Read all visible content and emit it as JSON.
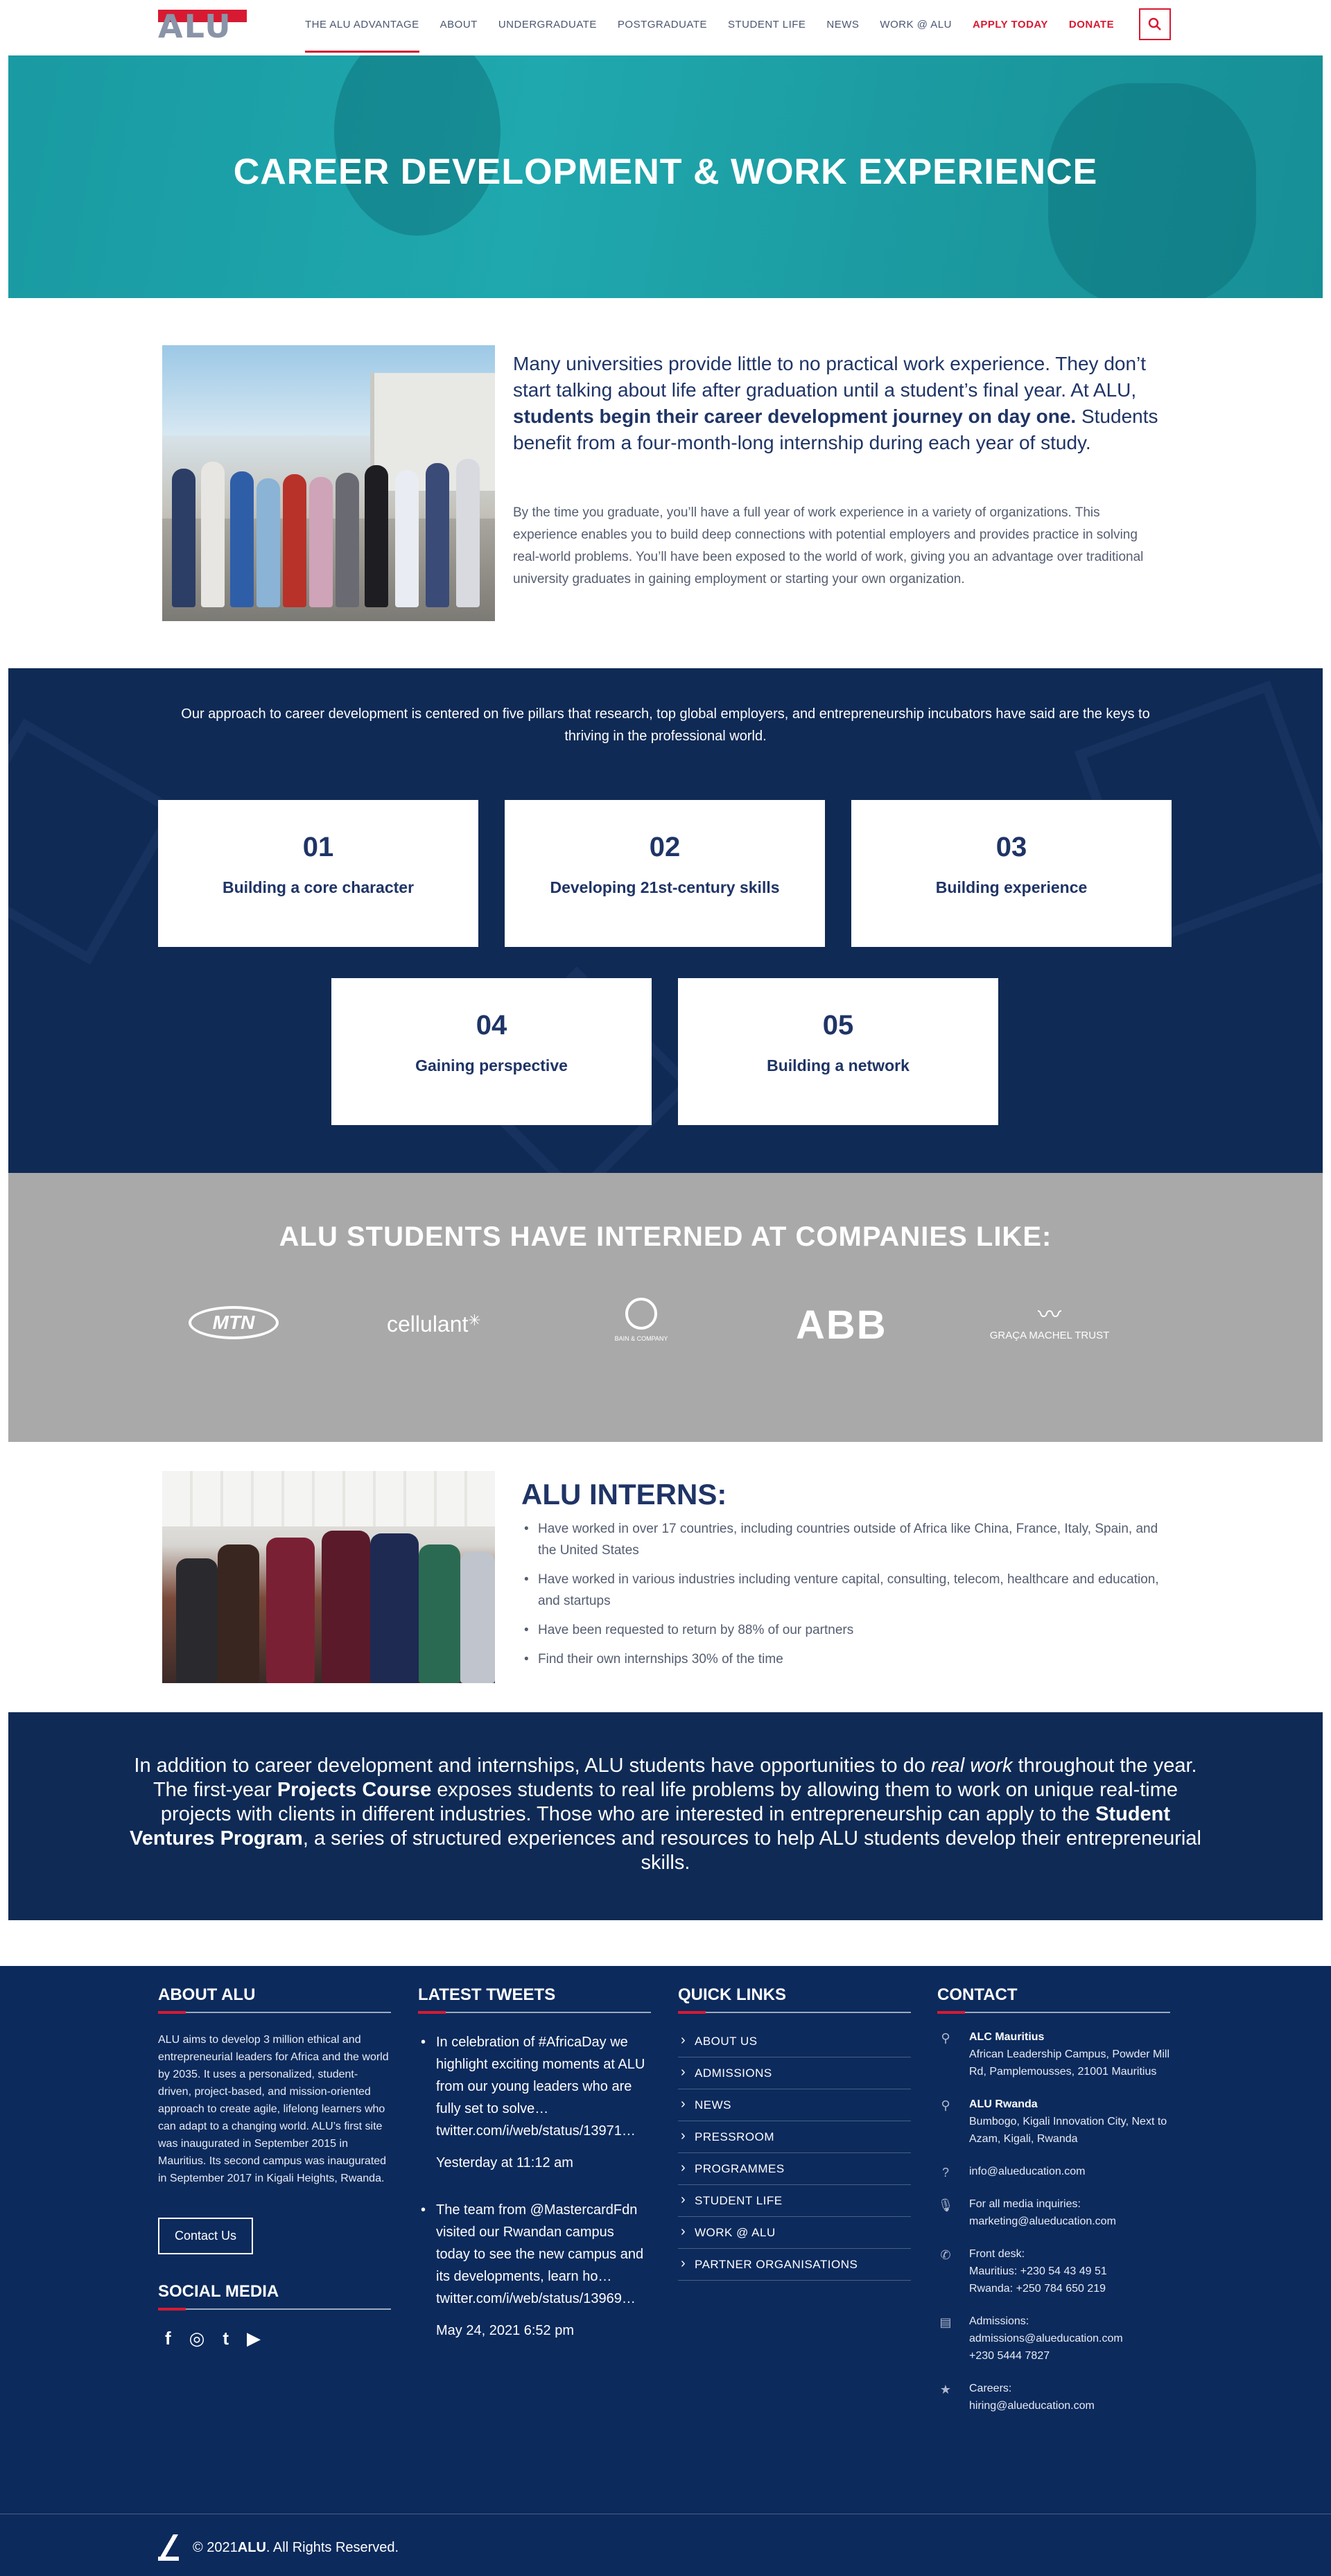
{
  "brand": {
    "logo_text": "ALU",
    "accent": "#d71a32",
    "navy": "#0f2a55",
    "teal": "#1fa8ae"
  },
  "nav": {
    "items": [
      "THE ALU ADVANTAGE",
      "ABOUT",
      "UNDERGRADUATE",
      "POSTGRADUATE",
      "STUDENT LIFE",
      "NEWS",
      "WORK @ ALU"
    ],
    "apply": "APPLY TODAY",
    "donate": "DONATE",
    "search_icon": "search-icon"
  },
  "hero": {
    "title": "CAREER DEVELOPMENT & WORK EXPERIENCE"
  },
  "intro": {
    "lead_start": "Many universities provide little to no practical work experience. They don’t start talking about life after graduation until a student’s final year. At ALU, ",
    "lead_bold": "students begin their career development journey on day one.",
    "lead_end": " Students benefit from a four-month-long internship during each year of study.",
    "body": "By the time you graduate, you’ll have a full year of work experience in a variety of organizations. This experience enables you to build deep connections with potential employers and provides practice in solving real-world problems. You’ll have been exposed to the world of work, giving you an advantage over traditional university graduates in gaining employment or starting your own organization."
  },
  "pillars": {
    "intro": "Our approach to career development is centered on five pillars that research, top global employers, and entrepreneurship incubators have said are the keys to thriving in the professional world.",
    "cards": [
      {
        "num": "01",
        "label": "Building a core character"
      },
      {
        "num": "02",
        "label": "Developing 21st-century skills"
      },
      {
        "num": "03",
        "label": "Building experience"
      },
      {
        "num": "04",
        "label": "Gaining perspective"
      },
      {
        "num": "05",
        "label": "Building a network"
      }
    ]
  },
  "companies": {
    "title": "ALU STUDENTS HAVE INTERNED AT COMPANIES LIKE:",
    "logos": {
      "mtn": "MTN",
      "cellulant": "cellulant",
      "bain": "BAIN & COMPANY",
      "abb": "ABB",
      "gmt": "GRAÇA MACHEL TRUST"
    }
  },
  "interns": {
    "title": "ALU INTERNS:",
    "items": [
      "Have worked in over 17 countries, including countries outside of Africa like China, France, Italy, Spain, and the United States",
      "Have worked in various industries including venture capital, consulting, telecom, healthcare and education, and startups",
      "Have been requested to return by 88% of our partners",
      "Find their own internships 30% of the time"
    ]
  },
  "realwork": {
    "p1": "In addition to career development and internships, ALU students have opportunities to do ",
    "em": "real work",
    "p2": " throughout the year. The first-year ",
    "b1": "Projects Course",
    "p3": " exposes students to real life problems by allowing them to work on unique real-time projects with clients in different industries. Those who are interested in entrepreneurship can apply to the ",
    "b2": "Student Ventures Program",
    "p4": ", a series of structured experiences and resources to help ALU students develop their entrepreneurial skills."
  },
  "footer": {
    "about": {
      "title": "ABOUT ALU",
      "text": "ALU aims to develop 3 million ethical and entrepreneurial leaders for Africa and the world by 2035. It uses a personalized, student-driven, project-based, and mission-oriented approach to create agile, lifelong learners who can adapt to a changing world. ALU’s first site was inaugurated in September 2015 in Mauritius. Its second campus was inaugurated in September 2017 in Kigali Heights, Rwanda.",
      "button": "Contact Us",
      "social_title": "SOCIAL MEDIA",
      "social": [
        "f",
        "◎",
        "t",
        "▶"
      ]
    },
    "tweets": {
      "title": "LATEST TWEETS",
      "items": [
        {
          "text": "In celebration of #AfricaDay we highlight exciting moments at ALU from our young leaders who are fully set to solve… twitter.com/i/web/status/13971…",
          "time": "Yesterday at 11:12 am"
        },
        {
          "text": "The team from @MastercardFdn visited our Rwandan campus today to see the new campus and its developments, learn ho… twitter.com/i/web/status/13969…",
          "time": "May 24, 2021 6:52 pm"
        }
      ]
    },
    "quick": {
      "title": "QUICK LINKS",
      "items": [
        "ABOUT US",
        "ADMISSIONS",
        "NEWS",
        "PRESSROOM",
        "PROGRAMMES",
        "STUDENT LIFE",
        "WORK @ ALU",
        "PARTNER ORGANISATIONS"
      ]
    },
    "contact": {
      "title": "CONTACT",
      "mauritius_name": "ALC Mauritius",
      "mauritius_addr": "African Leadership Campus, Powder Mill Rd, Pamplemousses, 21001 Mauritius",
      "rwanda_name": "ALU Rwanda",
      "rwanda_addr": "Bumbogo, Kigali Innovation City, Next to Azam, Kigali, Rwanda",
      "info": "info@alueducation.com",
      "media_label": "For all media inquiries:",
      "media_email": "marketing@alueducation.com",
      "front_label": "Front desk:",
      "front_mu": "Mauritius: +230 54 43 49 51",
      "front_rw": "Rwanda: +250 784 650 219",
      "adm_label": "Admissions:",
      "adm_email": "admissions@alueducation.com",
      "adm_phone": "+230 5444 7827",
      "careers_label": "Careers:",
      "careers_email": "hiring@alueducation.com"
    },
    "copyright_pre": "© 2021 ",
    "copyright_brand": "ALU",
    "copyright_post": ". All Rights Reserved."
  }
}
